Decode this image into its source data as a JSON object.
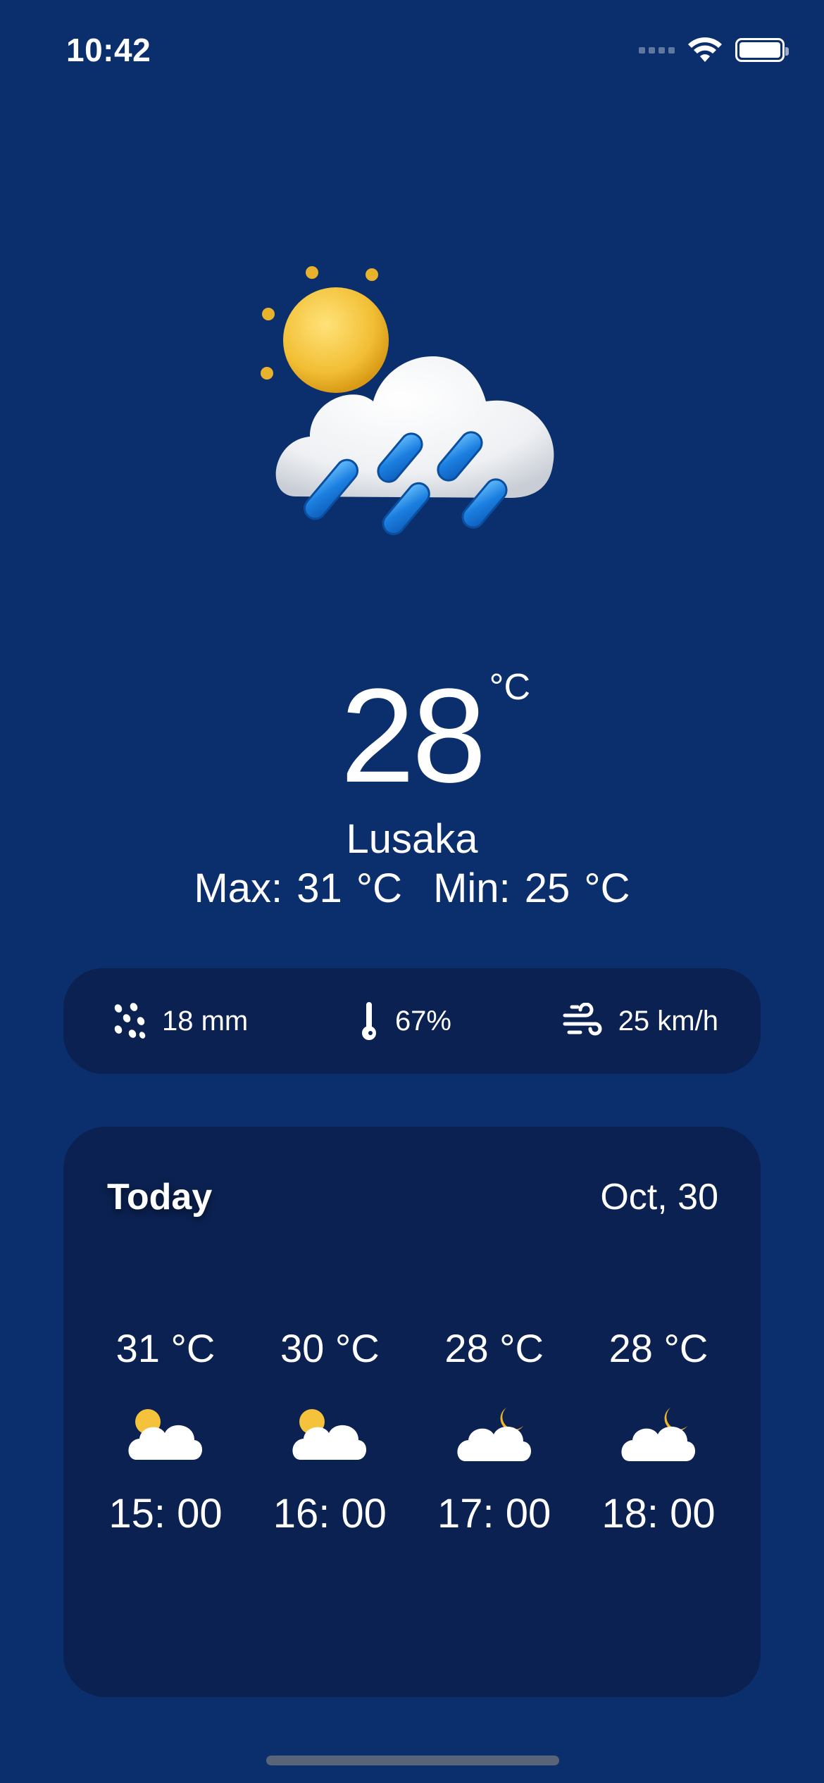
{
  "status_bar": {
    "time": "10:42",
    "icons": [
      "cellular-signal-icon",
      "wifi-icon",
      "battery-icon"
    ]
  },
  "hero": {
    "icon": "sun-cloud-rain-icon"
  },
  "current": {
    "temperature": "28",
    "unit": "°C",
    "city": "Lusaka",
    "max": "Max: 31 °C",
    "min": "Min: 25 °C"
  },
  "stats": {
    "rain": {
      "icon": "raindrops-icon",
      "value": "18 mm"
    },
    "humidity": {
      "icon": "thermometer-icon",
      "value": "67%"
    },
    "wind": {
      "icon": "wind-icon",
      "value": "25 km/h"
    }
  },
  "forecast": {
    "title": "Today",
    "date": "Oct, 30",
    "hours": [
      {
        "temp": "31 °C",
        "icon": "partly-sunny-icon",
        "time": "15: 00"
      },
      {
        "temp": "30 °C",
        "icon": "partly-sunny-icon",
        "time": "16: 00"
      },
      {
        "temp": "28 °C",
        "icon": "partly-cloudy-night-icon",
        "time": "17: 00"
      },
      {
        "temp": "28 °C",
        "icon": "partly-cloudy-night-icon",
        "time": "18: 00"
      }
    ]
  },
  "colors": {
    "background": "#0b2e6c",
    "card": "#0b2151",
    "sun": "#f5c33b",
    "moon": "#f0b52a",
    "rain": "#2b8ee8"
  }
}
